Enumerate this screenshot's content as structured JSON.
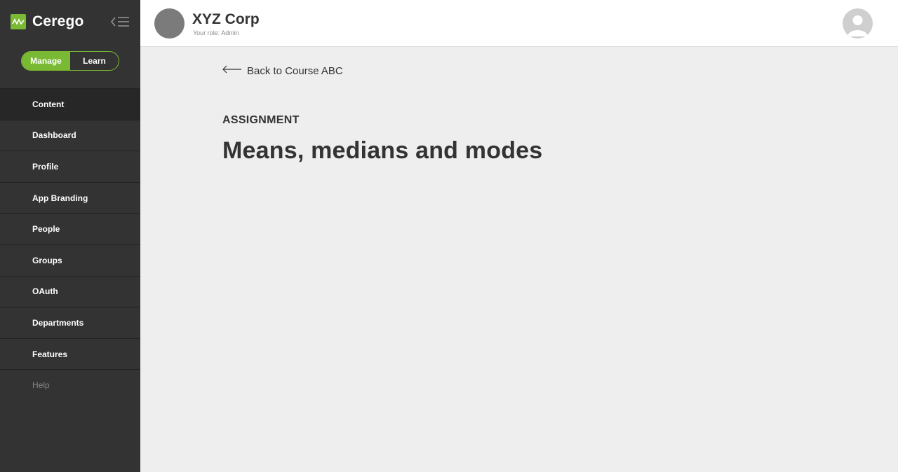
{
  "brand": {
    "name": "Cerego",
    "logo_icon": "wave-logo-icon",
    "accent": "#79b933"
  },
  "sidebar": {
    "collapse_icon": "collapse-menu-icon",
    "mode_toggle": {
      "options": [
        "Manage",
        "Learn"
      ],
      "selected": "Manage"
    },
    "items": [
      {
        "label": "Content",
        "active": true
      },
      {
        "label": "Dashboard"
      },
      {
        "label": "Profile"
      },
      {
        "label": "App Branding"
      },
      {
        "label": "People"
      },
      {
        "label": "Groups"
      },
      {
        "label": "OAuth"
      },
      {
        "label": "Departments"
      },
      {
        "label": "Features"
      },
      {
        "label": "Help",
        "muted": true
      }
    ]
  },
  "header": {
    "org_name": "XYZ Corp",
    "role_text": "Your role: Admin",
    "user_avatar_icon": "user-avatar-icon"
  },
  "main": {
    "back_link": "Back to Course ABC",
    "back_icon": "arrow-left-icon",
    "kicker": "ASSIGNMENT",
    "title": "Means, medians and modes"
  }
}
